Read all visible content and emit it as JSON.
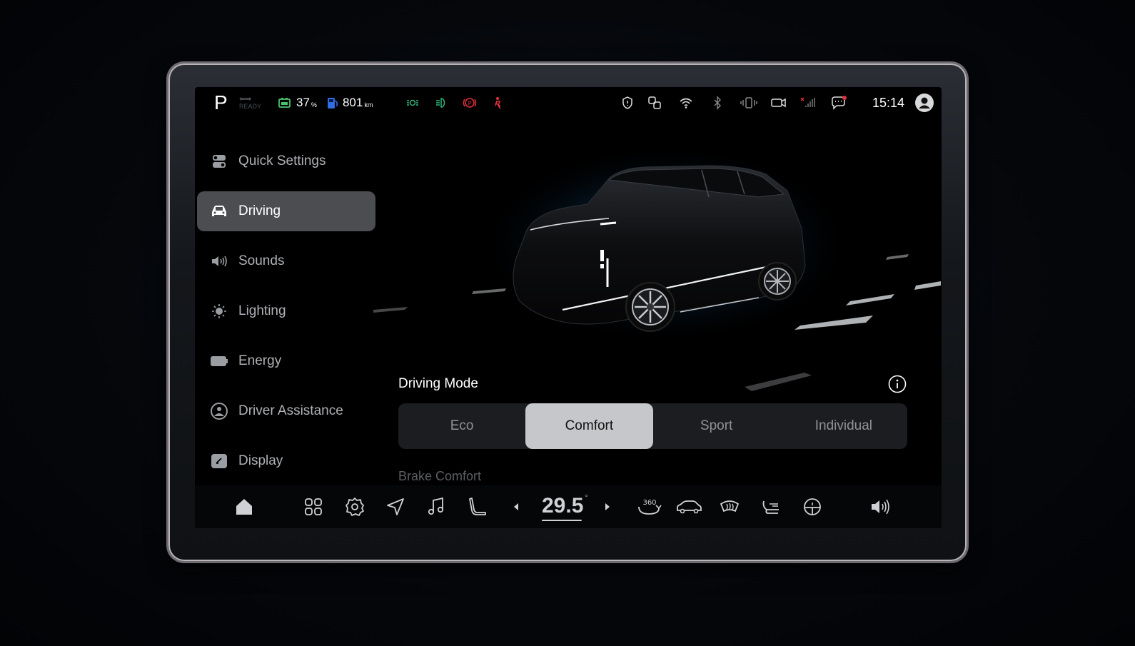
{
  "status": {
    "gear": "P",
    "ready_label": "READY",
    "battery_pct": "37",
    "battery_unit": "%",
    "range": "801",
    "range_unit": "km",
    "time": "15:14"
  },
  "nav": {
    "items": [
      {
        "label": "Quick Settings",
        "icon": "toggles-icon"
      },
      {
        "label": "Driving",
        "icon": "car-icon"
      },
      {
        "label": "Sounds",
        "icon": "speaker-icon"
      },
      {
        "label": "Lighting",
        "icon": "lightbulb-icon"
      },
      {
        "label": "Energy",
        "icon": "battery-icon"
      },
      {
        "label": "Driver Assistance",
        "icon": "steering-wheel-icon"
      },
      {
        "label": "Display",
        "icon": "display-icon"
      }
    ],
    "active_index": 1
  },
  "driving": {
    "mode_title": "Driving Mode",
    "modes": [
      "Eco",
      "Comfort",
      "Sport",
      "Individual"
    ],
    "selected_mode": "Comfort",
    "next_section": "Brake Comfort"
  },
  "dock": {
    "temperature": "29.5",
    "temp_unit": "°",
    "icon_360_label": "360"
  },
  "colors": {
    "accent_green": "#2fb87a",
    "alert_red": "#e0303a",
    "battery_green": "#49c26b",
    "range_blue": "#2e6de3",
    "selected_segment": "#c6c7ca",
    "nav_active_bg": "#4b4d51"
  }
}
